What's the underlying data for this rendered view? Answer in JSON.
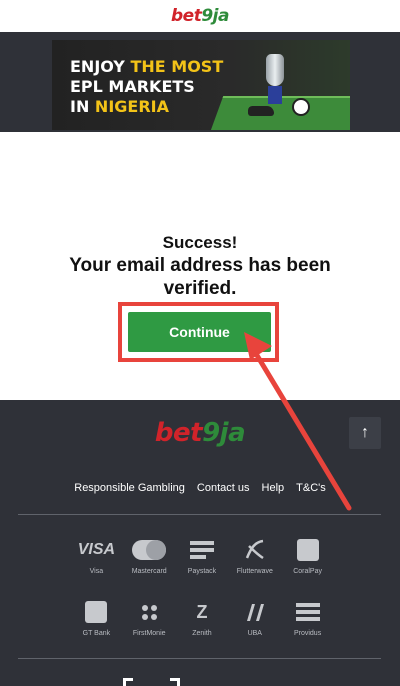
{
  "header": {
    "logo_part1": "bet",
    "logo_part2": "9ja"
  },
  "banner": {
    "line1_a": "ENJOY ",
    "line1_b": "THE MOST",
    "line2": "EPL MARKETS",
    "line3_a": "IN ",
    "line3_b": "NIGERIA"
  },
  "message": {
    "title": "Success!",
    "line1": "Your email address has been",
    "line2": "verified."
  },
  "continue_button": "Continue",
  "footer": {
    "logo_part1": "bet",
    "logo_part2": "9ja",
    "back_to_top_icon": "↑",
    "links": [
      "Responsible Gambling",
      "Contact us",
      "Help",
      "T&C's"
    ],
    "payments_row1": [
      "Visa",
      "Mastercard",
      "Paystack",
      "Flutterwave",
      "CoralPay"
    ],
    "payments_row2": [
      "GT Bank",
      "FirstMonie",
      "Zenith",
      "UBA",
      "Providus"
    ],
    "visa_mark": "VISA",
    "zenith_mark": "Z"
  },
  "colors": {
    "brand_red": "#d1232a",
    "brand_green": "#2e8b3a",
    "button_green": "#2f9a43",
    "highlight_red": "#e8443c",
    "footer_bg": "#2f3138"
  }
}
